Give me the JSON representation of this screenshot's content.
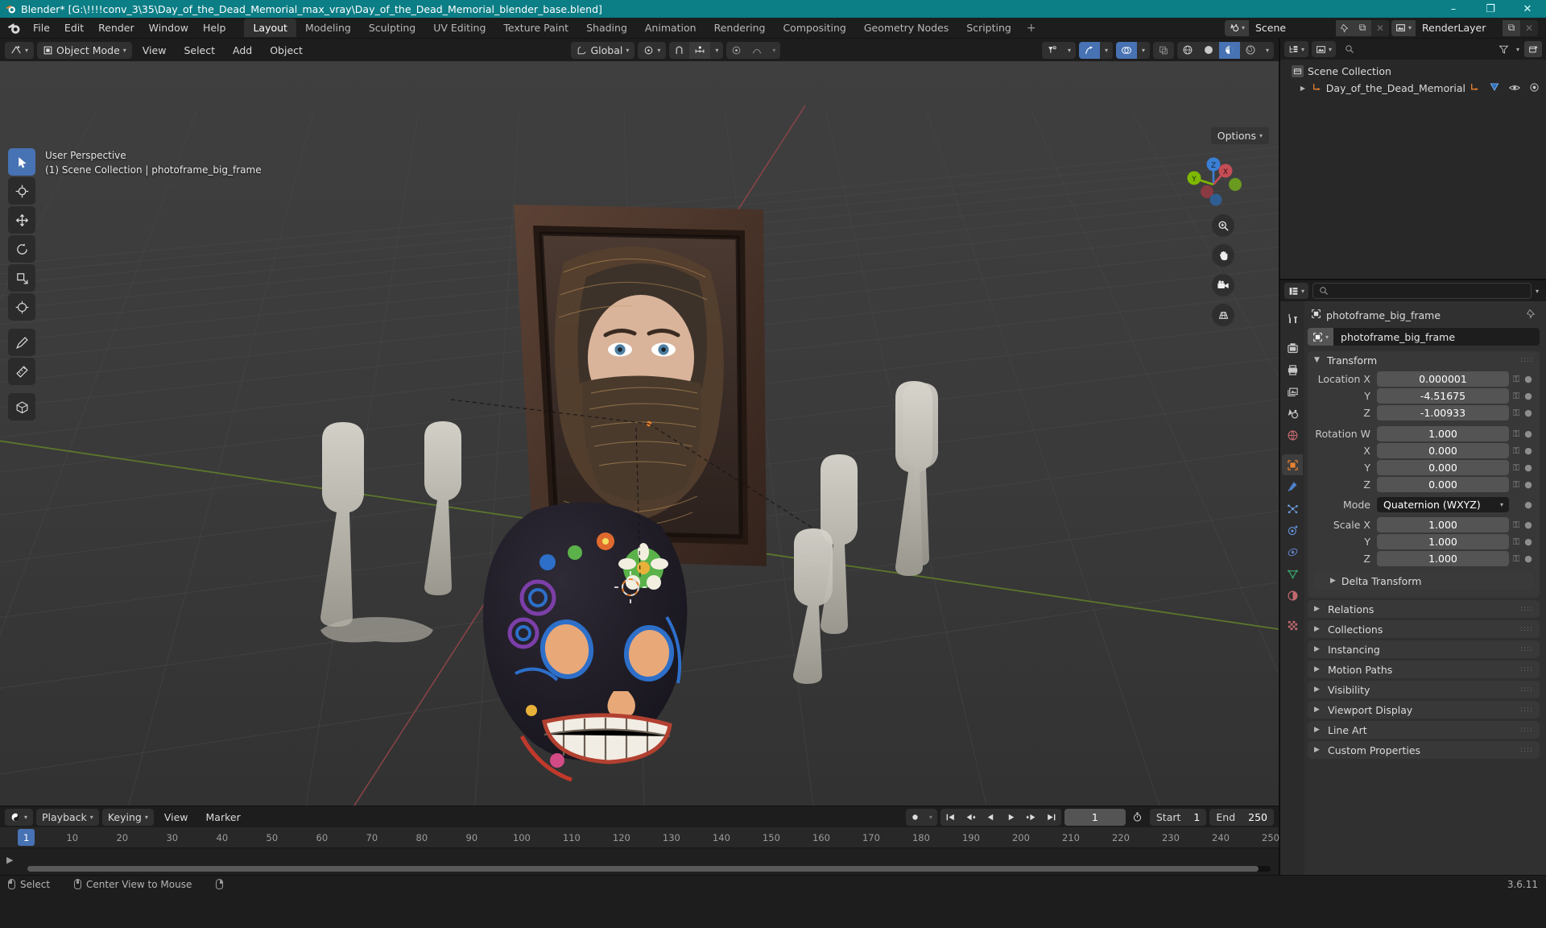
{
  "window": {
    "title": "Blender* [G:\\!!!!conv_3\\35\\Day_of_the_Dead_Memorial_max_vray\\Day_of_the_Dead_Memorial_blender_base.blend]",
    "minimize": "–",
    "maximize": "❐",
    "close": "✕"
  },
  "topbar": {
    "menus": [
      "File",
      "Edit",
      "Render",
      "Window",
      "Help"
    ],
    "workspaces": [
      {
        "label": "Layout",
        "active": true
      },
      {
        "label": "Modeling",
        "active": false
      },
      {
        "label": "Sculpting",
        "active": false
      },
      {
        "label": "UV Editing",
        "active": false
      },
      {
        "label": "Texture Paint",
        "active": false
      },
      {
        "label": "Shading",
        "active": false
      },
      {
        "label": "Animation",
        "active": false
      },
      {
        "label": "Rendering",
        "active": false
      },
      {
        "label": "Compositing",
        "active": false
      },
      {
        "label": "Geometry Nodes",
        "active": false
      },
      {
        "label": "Scripting",
        "active": false
      }
    ],
    "add_workspace": "+",
    "scene": {
      "name": "Scene",
      "new_label": "⧉",
      "remove_label": "✕"
    },
    "view_layer": {
      "name": "RenderLayer",
      "new_label": "⧉",
      "remove_label": "✕"
    }
  },
  "viewport_header": {
    "mode": "Object Mode",
    "menus": [
      "View",
      "Select",
      "Add",
      "Object"
    ],
    "transform_orientation": "Global",
    "options_label": "Options"
  },
  "viewport": {
    "perspective": "User Perspective",
    "breadcrumb": "(1) Scene Collection | photoframe_big_frame",
    "gizmo_axes": [
      {
        "label": "Z",
        "color": "#3b7fd4"
      },
      {
        "label": "X",
        "color": "#c44d56"
      },
      {
        "label": "Y",
        "color": "#7fb800"
      }
    ]
  },
  "outliner": {
    "search_placeholder": "",
    "rows": [
      {
        "label": "Scene Collection",
        "indent": 0,
        "type": "collection",
        "expandable": false
      },
      {
        "label": "Day_of_the_Dead_Memorial",
        "indent": 1,
        "type": "object",
        "expandable": true
      }
    ]
  },
  "properties": {
    "search_placeholder": "",
    "breadcrumb_object": "photoframe_big_frame",
    "id_name": "photoframe_big_frame",
    "transform": {
      "title": "Transform",
      "location": {
        "label_x": "Location X",
        "label_y": "Y",
        "label_z": "Z",
        "x": "0.000001",
        "y": "-4.51675",
        "z": "-1.00933"
      },
      "rotation": {
        "label_w": "Rotation W",
        "label_x": "X",
        "label_y": "Y",
        "label_z": "Z",
        "w": "1.000",
        "x": "0.000",
        "y": "0.000",
        "z": "0.000"
      },
      "mode_label": "Mode",
      "mode_value": "Quaternion (WXYZ)",
      "scale": {
        "label_x": "Scale X",
        "label_y": "Y",
        "label_z": "Z",
        "x": "1.000",
        "y": "1.000",
        "z": "1.000"
      },
      "delta_transform": "Delta Transform"
    },
    "panels": [
      "Relations",
      "Collections",
      "Instancing",
      "Motion Paths",
      "Visibility",
      "Viewport Display",
      "Line Art",
      "Custom Properties"
    ]
  },
  "timeline": {
    "editor_menus": [
      "Playback",
      "Keying",
      "View",
      "Marker"
    ],
    "current_frame": "1",
    "start_label": "Start",
    "start_value": "1",
    "end_label": "End",
    "end_value": "250",
    "ticks": [
      "10",
      "20",
      "30",
      "40",
      "50",
      "60",
      "70",
      "80",
      "90",
      "100",
      "110",
      "120",
      "130",
      "140",
      "150",
      "160",
      "170",
      "180",
      "190",
      "200",
      "210",
      "220",
      "230",
      "240",
      "250"
    ],
    "playhead_label": "1"
  },
  "statusbar": {
    "select": "Select",
    "center_view": "Center View to Mouse",
    "version": "3.6.11"
  },
  "colors": {
    "title_bar": "#0b7e86",
    "accent_blue": "#4772b3",
    "panel_bg": "#303030",
    "field_bg": "#545454",
    "axis_x": "#c44d56",
    "axis_y": "#7fb800",
    "axis_z": "#3b7fd4",
    "orange": "#e8812e"
  }
}
